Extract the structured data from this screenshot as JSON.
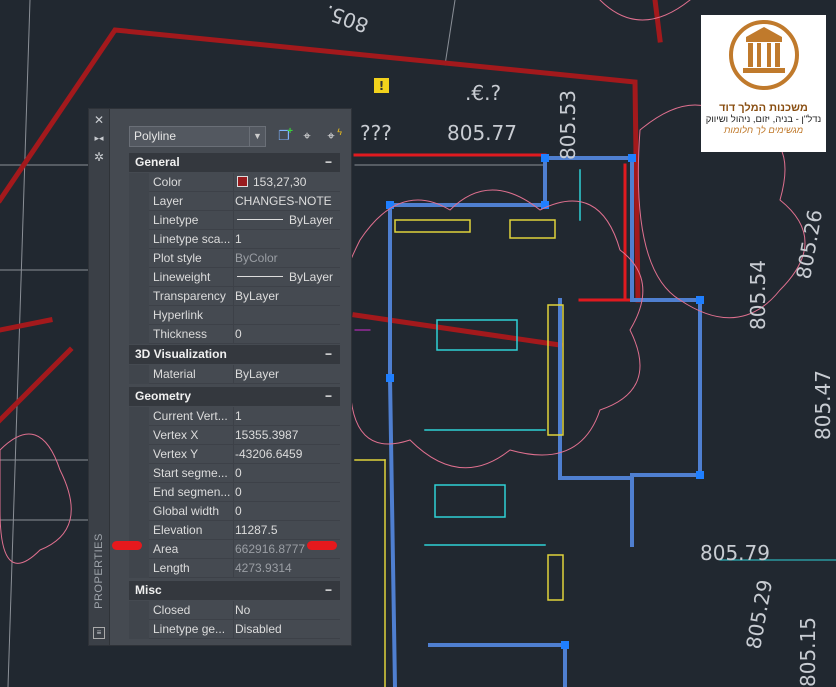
{
  "canvas": {
    "background": "#212830",
    "labels": [
      "805.77",
      "805.53",
      "805.54",
      "805.26",
      "805.47",
      "805.79",
      "805.29",
      "805.15",
      ".€.?",
      "???",
      "805."
    ],
    "warning_icon": "exclamation-warning-icon"
  },
  "logo": {
    "name": "משכנות המלך דוד",
    "tagline": "נדל\"ן - בניה, יזום, ניהול ושיווק",
    "slogan": "מגשימים לך חלומות"
  },
  "properties": {
    "palette_title": "PROPERTIES",
    "object_type": "Polyline",
    "toolbar": [
      "toggle-pickadd-icon",
      "select-objects-icon",
      "quick-select-icon"
    ],
    "sections": [
      {
        "title": "General",
        "collapse": "−",
        "rows": [
          {
            "label": "Color",
            "value": "153,27,30",
            "swatch": "#991b1e"
          },
          {
            "label": "Layer",
            "value": "CHANGES-NOTE"
          },
          {
            "label": "Linetype",
            "value": "ByLayer",
            "line": true
          },
          {
            "label": "Linetype sca...",
            "value": "1"
          },
          {
            "label": "Plot style",
            "value": "ByColor",
            "dim": true
          },
          {
            "label": "Lineweight",
            "value": "ByLayer",
            "line": true
          },
          {
            "label": "Transparency",
            "value": "ByLayer"
          },
          {
            "label": "Hyperlink",
            "value": ""
          },
          {
            "label": "Thickness",
            "value": "0"
          }
        ]
      },
      {
        "title": "3D Visualization",
        "collapse": "−",
        "rows": [
          {
            "label": "Material",
            "value": "ByLayer"
          }
        ]
      },
      {
        "title": "Geometry",
        "collapse": "−",
        "rows": [
          {
            "label": "Current Vert...",
            "value": "1"
          },
          {
            "label": "Vertex X",
            "value": "15355.3987"
          },
          {
            "label": "Vertex Y",
            "value": "-43206.6459"
          },
          {
            "label": "Start segme...",
            "value": "0"
          },
          {
            "label": "End segmen...",
            "value": "0"
          },
          {
            "label": "Global width",
            "value": "0"
          },
          {
            "label": "Elevation",
            "value": "11287.5"
          },
          {
            "label": "Area",
            "value": "662916.8777",
            "dim": true,
            "highlighted": true
          },
          {
            "label": "Length",
            "value": "4273.9314",
            "dim": true
          }
        ]
      },
      {
        "title": "Misc",
        "collapse": "−",
        "rows": [
          {
            "label": "Closed",
            "value": "No"
          },
          {
            "label": "Linetype ge...",
            "value": "Disabled"
          }
        ]
      }
    ],
    "highlight_color": "#e5191d"
  }
}
